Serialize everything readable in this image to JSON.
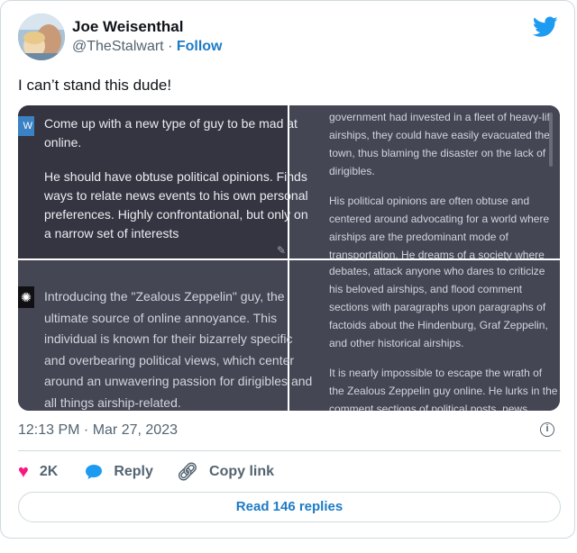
{
  "author": {
    "name": "Joe Weisenthal",
    "handle": "@TheStalwart",
    "separator": "·",
    "follow_label": "Follow"
  },
  "tweet": {
    "text": "I can’t stand this dude!",
    "timestamp": "12:13 PM · Mar 27, 2023"
  },
  "media": {
    "user_icon_letters": "W",
    "prompt_lines": [
      "Come up with a new type of guy to be mad at",
      "online.",
      "",
      "He should have obtuse political opinions. Finds",
      "ways to relate news events to his own personal",
      "preferences. Highly confrontational, but only on",
      "a narrow set of interests"
    ],
    "answer_lines": [
      "Introducing the \"Zealous Zeppelin\" guy, the",
      "ultimate source of online annoyance. This",
      "individual is known for their bizarrely specific",
      "and overbearing political views, which center",
      "around an unwavering passion for dirigibles and",
      "all things airship-related."
    ],
    "right_top_lines": [
      "government had invested in a fleet of heavy-lift",
      "airships, they could have easily evacuated the",
      "town, thus blaming the disaster on the lack of",
      "dirigibles.",
      "",
      "His political opinions are often obtuse and",
      "centered around advocating for a world where",
      "airships are the predominant mode of",
      "transportation. He dreams of a society where"
    ],
    "right_bottom_lines": [
      "debates, attack anyone who dares to criticize",
      "his beloved airships, and flood comment",
      "sections with paragraphs upon paragraphs of",
      "factoids about the Hindenburg, Graf Zeppelin,",
      "and other historical airships.",
      "",
      "It is nearly impossible to escape the wrath of",
      "the Zealous Zeppelin guy online. He lurks in the",
      "comment sections of political posts, news"
    ]
  },
  "actions": {
    "likes": "2K",
    "reply_label": "Reply",
    "copy_link_label": "Copy link"
  },
  "read_replies_label": "Read 146 replies",
  "colors": {
    "brand_blue": "#1d9bf0",
    "link_blue": "#1d7bc6",
    "like_pink": "#f91880"
  },
  "icons": [
    "twitter-bird-icon",
    "info-icon",
    "heart-icon",
    "reply-bubble-icon",
    "link-icon",
    "edit-icon",
    "chatgpt-logo-icon"
  ]
}
